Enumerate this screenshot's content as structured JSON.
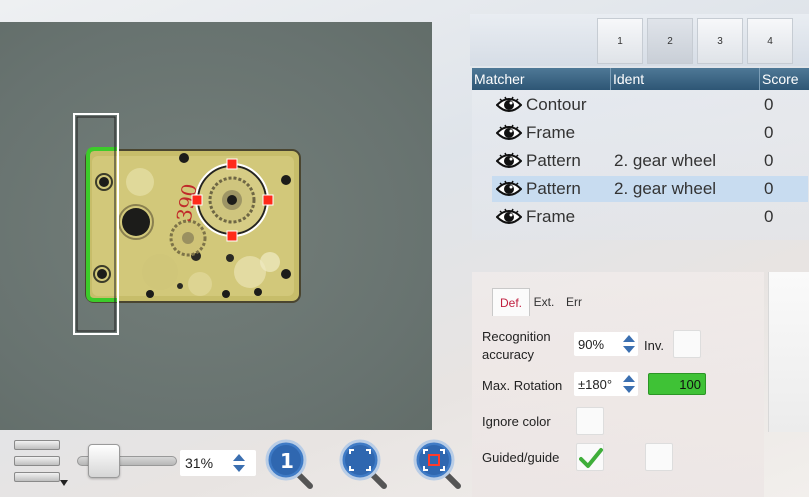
{
  "viewer": {
    "overlay_color": "#3ccb2a",
    "handle_color": "#ff2a1a"
  },
  "toolbar": {
    "zoom_value": "31%",
    "zoom_slider_fraction": 0.15,
    "buttons": [
      "zoom-1-1-icon",
      "zoom-fit-icon",
      "zoom-selection-icon"
    ]
  },
  "tabs": [
    "1",
    "2",
    "3",
    "4"
  ],
  "active_tab": "2",
  "grid": {
    "headers": {
      "matcher": "Matcher",
      "ident": "Ident",
      "score": "Score"
    },
    "rows": [
      {
        "matcher": "Contour",
        "ident": "",
        "score": "0",
        "selected": false
      },
      {
        "matcher": "Frame",
        "ident": "",
        "score": "0",
        "selected": false
      },
      {
        "matcher": "Pattern",
        "ident": "2. gear wheel",
        "score": "0",
        "selected": false
      },
      {
        "matcher": "Pattern",
        "ident": "2. gear wheel",
        "score": "0",
        "selected": true
      },
      {
        "matcher": "Frame",
        "ident": "",
        "score": "0",
        "selected": false
      }
    ]
  },
  "props": {
    "tabs": {
      "def": "Def.",
      "ext": "Ext.",
      "err": "Err"
    },
    "recognition_label_1": "Recognition",
    "recognition_label_2": "accuracy",
    "recognition_value": "90%",
    "inv_label": "Inv.",
    "rotation_label": "Max. Rotation",
    "rotation_value": "±180°",
    "rotation_score": "100",
    "ignore_color_label": "Ignore color",
    "guided_label": "Guided/guide",
    "guided_checked": true,
    "accent_green": "#3fc236"
  }
}
